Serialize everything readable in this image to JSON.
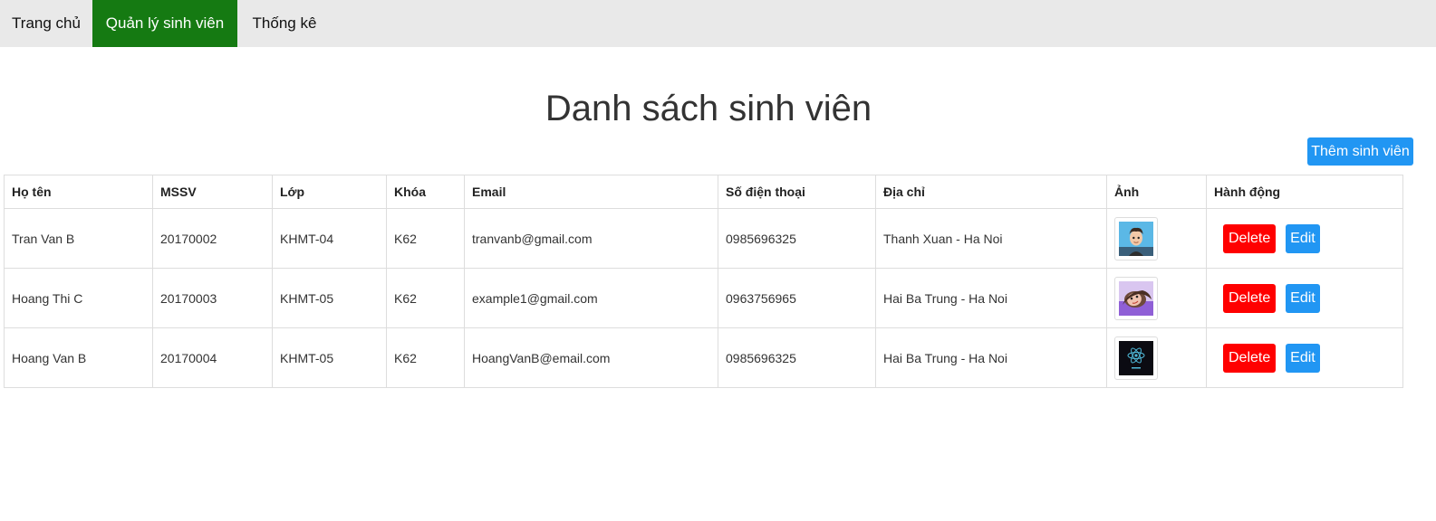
{
  "nav": {
    "items": [
      {
        "label": "Trang chủ"
      },
      {
        "label": "Quản lý sinh viên"
      },
      {
        "label": "Thống kê"
      }
    ],
    "active_color": "#157a12"
  },
  "page": {
    "title": "Danh sách sinh viên",
    "add_button_label": "Thêm sinh viên"
  },
  "table": {
    "headers": [
      "Họ tên",
      "MSSV",
      "Lớp",
      "Khóa",
      "Email",
      "Số điện thoại",
      "Địa chỉ",
      "Ảnh",
      "Hành động"
    ],
    "rows": [
      {
        "name": "Tran Van B",
        "mssv": "20170002",
        "class": "KHMT-04",
        "course": "K62",
        "email": "tranvanb@gmail.com",
        "phone": "0985696325",
        "address": "Thanh Xuan - Ha Noi",
        "photo_icon": "avatar-cartoon-man-icon",
        "delete_label": "Delete",
        "edit_label": "Edit"
      },
      {
        "name": "Hoang Thi C",
        "mssv": "20170003",
        "class": "KHMT-05",
        "course": "K62",
        "email": "example1@gmail.com",
        "phone": "0963756965",
        "address": "Hai Ba Trung - Ha Noi",
        "photo_icon": "avatar-cartoon-woman-icon",
        "delete_label": "Delete",
        "edit_label": "Edit"
      },
      {
        "name": "Hoang Van B",
        "mssv": "20170004",
        "class": "KHMT-05",
        "course": "K62",
        "email": "HoangVanB@email.com",
        "phone": "0985696325",
        "address": "Hai Ba Trung - Ha Noi",
        "photo_icon": "react-logo-icon",
        "delete_label": "Delete",
        "edit_label": "Edit"
      }
    ]
  },
  "colors": {
    "delete": "#ff0000",
    "primary": "#2196f3",
    "nav_bg": "#e9e9e9"
  }
}
